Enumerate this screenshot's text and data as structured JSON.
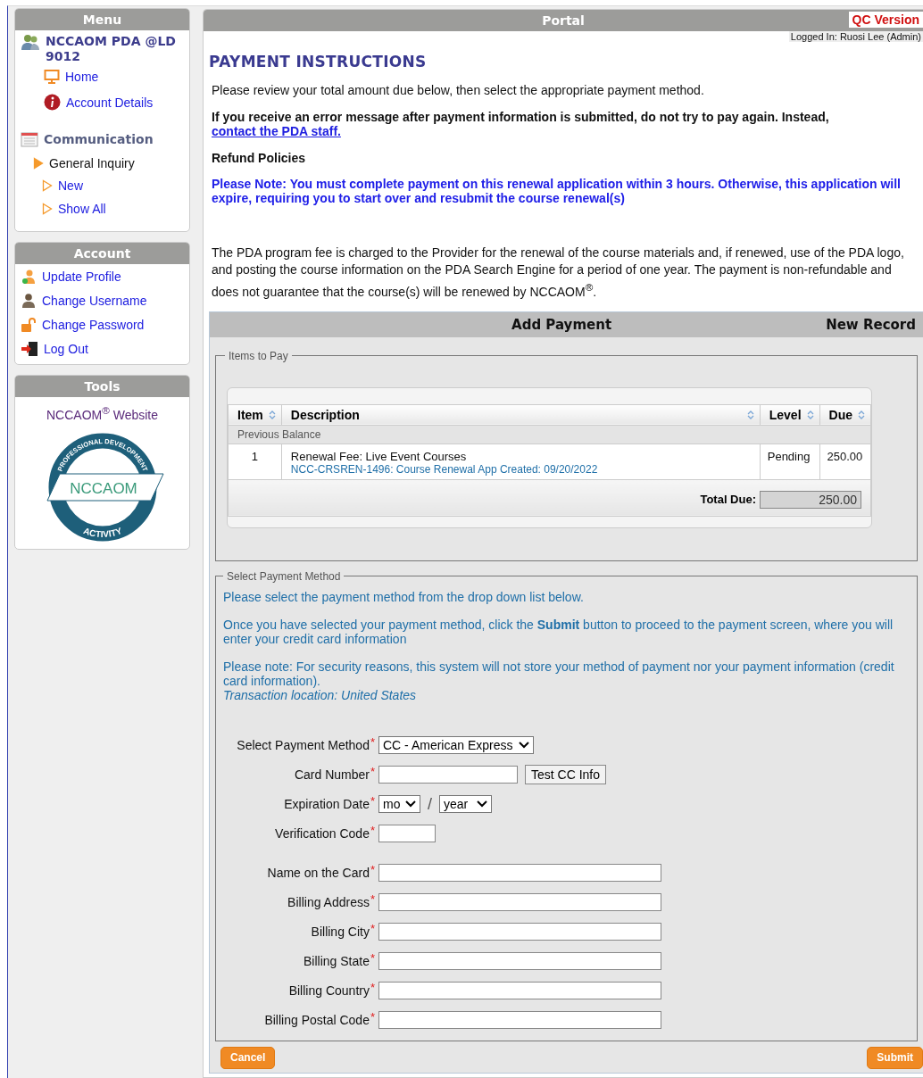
{
  "menu": {
    "title": "Menu",
    "user": "NCCAOM PDA @LD 9012",
    "links": [
      {
        "label": "Home"
      },
      {
        "label": "Account Details"
      }
    ],
    "section": {
      "title": "Communication",
      "items": [
        {
          "label": "General Inquiry",
          "expanded": true,
          "children": [
            {
              "label": "New"
            },
            {
              "label": "Show All"
            }
          ]
        }
      ]
    }
  },
  "account": {
    "title": "Account",
    "links": [
      {
        "label": "Update Profile"
      },
      {
        "label": "Change Username"
      },
      {
        "label": "Change Password"
      },
      {
        "label": "Log Out"
      }
    ]
  },
  "tools": {
    "title": "Tools",
    "link": "NCCAOM$^{®}$ Website",
    "logo": {
      "top": "PROFESSIONAL DEVELOPMENT",
      "middle": "NCCAOM",
      "bottom": "ACTIVITY"
    }
  },
  "portal": {
    "title": "Portal",
    "badge": "QC Version",
    "logged_in": "Logged In: Ruosi Lee (Admin)"
  },
  "heading": "PAYMENT INSTRUCTIONS",
  "intro": "Please review your total amount due below, then select the appropriate payment method.",
  "warning": {
    "text": "If you receive an error message after payment information is submitted, do not try to pay again. Instead,",
    "link": "contact the PDA staff."
  },
  "refund": "Refund Policies",
  "note": "Please Note: You must complete payment on this renewal application within 3 hours. Otherwise, this application will expire, requiring you to start over and resubmit the course renewal(s)",
  "fee_text": "The PDA program fee is charged to the Provider for the renewal of the course materials and, if renewed, use of the PDA logo, and posting the course information on the PDA Search Engine for a period of one year. The payment is non-refundable and does not guarantee that the course(s) will be renewed by NCCAOM$^{®}$.",
  "payment": {
    "title": "Add Payment",
    "status": "New Record",
    "items_legend": "Items to Pay",
    "table": {
      "columns": [
        {
          "label": "Item"
        },
        {
          "label": "Description"
        },
        {
          "label": "Level"
        },
        {
          "label": "Due"
        }
      ],
      "group": "Previous Balance",
      "rows": [
        {
          "item": "1",
          "description": "Renewal Fee: Live Event Courses",
          "detail": "NCC-CRSREN-1496: Course Renewal App Created: 09/20/2022",
          "level": "Pending",
          "due": "250.00"
        }
      ],
      "total_label": "Total Due:",
      "total": "250.00"
    },
    "method_legend": "Select Payment Method",
    "info": [
      "Please select the payment method from the drop down list below.",
      "Once you have selected your payment method, click the **Submit** button to proceed to the payment screen, where you will enter your credit card information",
      "Please note: For security reasons, this system will not store your method of payment nor your payment information (credit card information)."
    ],
    "location": "Transaction location: United States",
    "card_fields": [
      {
        "kind": "select",
        "label": "Select Payment Method",
        "mark": "*",
        "value": "CC - American Express"
      },
      {
        "kind": "card",
        "label": "Card Number",
        "mark": "*",
        "button": "Test CC Info"
      },
      {
        "kind": "date",
        "label": "Expiration Date",
        "mark": "*",
        "month": "mo",
        "separator": "/",
        "year": "year"
      },
      {
        "kind": "code",
        "label": "Verification Code",
        "mark": "*"
      }
    ],
    "billing_fields": [
      {
        "kind": "text",
        "label": "Name on the Card",
        "mark": "*"
      },
      {
        "kind": "text",
        "label": "Billing Address",
        "mark": "*"
      },
      {
        "kind": "text",
        "label": "Billing City",
        "mark": "*"
      },
      {
        "kind": "text",
        "label": "Billing State",
        "mark": "*"
      },
      {
        "kind": "text",
        "label": "Billing Country",
        "mark": "*"
      },
      {
        "kind": "text",
        "label": "Billing Postal Code",
        "mark": "*"
      }
    ],
    "buttons": {
      "cancel": "Cancel",
      "submit": "Submit"
    }
  }
}
